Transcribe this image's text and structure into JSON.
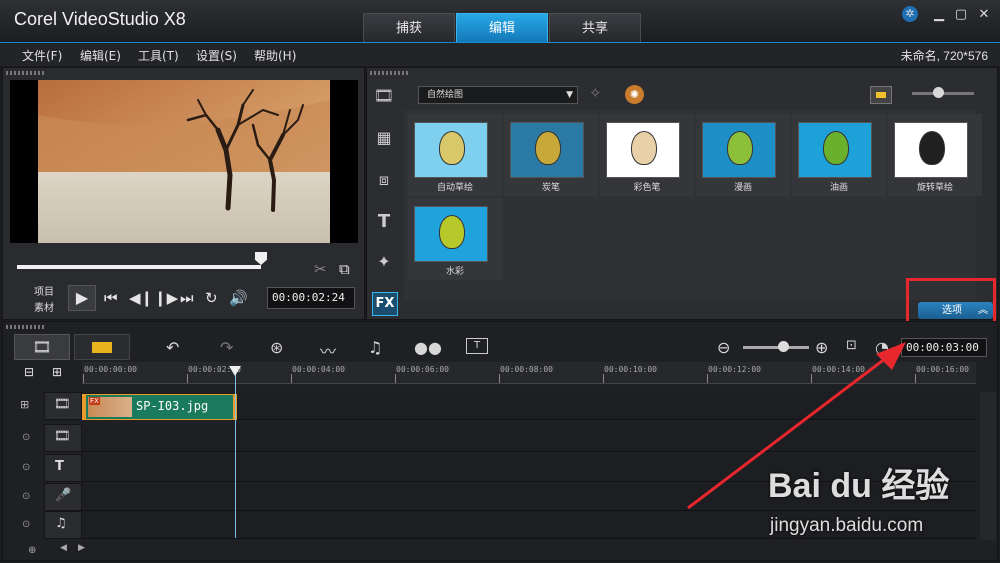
{
  "app": {
    "title": "Corel VideoStudio X8"
  },
  "tabs": [
    {
      "label": "捕获"
    },
    {
      "label": "编辑"
    },
    {
      "label": "共享"
    }
  ],
  "menu": {
    "items": [
      {
        "label": "文件(F)"
      },
      {
        "label": "编辑(E)"
      },
      {
        "label": "工具(T)"
      },
      {
        "label": "设置(S)"
      },
      {
        "label": "帮助(H)"
      }
    ],
    "project_info": "未命名, 720*576"
  },
  "player": {
    "mode_project": "项目",
    "mode_clip": "素材",
    "timecode": "00:00:02:24"
  },
  "library": {
    "filter_dropdown": "自然绘图",
    "items": [
      {
        "label": "自动草绘"
      },
      {
        "label": "炭笔"
      },
      {
        "label": "彩色笔"
      },
      {
        "label": "漫画"
      },
      {
        "label": "油画"
      },
      {
        "label": "旋转草绘"
      },
      {
        "label": "水彩"
      }
    ],
    "options_label": "选项"
  },
  "timeline": {
    "zoom_timecode": "00:00:03:00",
    "ruler": [
      "00:00:00:00",
      "00:00:02:00",
      "00:00:04:00",
      "00:00:06:00",
      "00:00:08:00",
      "00:00:10:00",
      "00:00:12:00",
      "00:00:14:00",
      "00:00:16:00"
    ],
    "clip": {
      "label": "SP-I03.jpg",
      "fx_badge": "FX"
    }
  },
  "watermark": {
    "brand": "Bai du 经验",
    "url": "jingyan.baidu.com"
  },
  "colors": {
    "accent": "#1e9de0",
    "highlight_box": "#e8262e",
    "arrow": "#e8262e",
    "clip_bg": "#1a7a5c"
  }
}
